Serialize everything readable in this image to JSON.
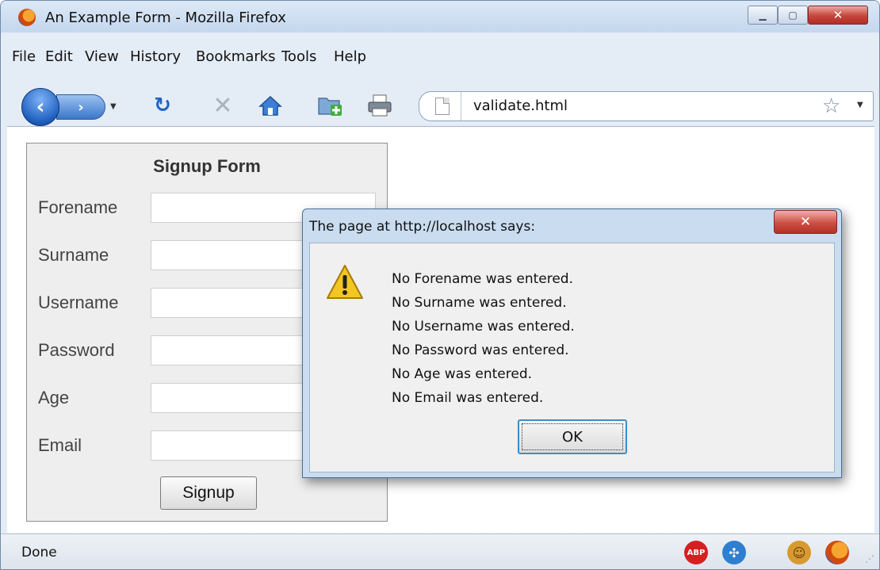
{
  "window": {
    "title": "An Example Form - Mozilla Firefox"
  },
  "menu": [
    {
      "label": "File"
    },
    {
      "label": "Edit"
    },
    {
      "label": "View"
    },
    {
      "label": "History"
    },
    {
      "label": "Bookmarks"
    },
    {
      "label": "Tools"
    },
    {
      "label": "Help"
    }
  ],
  "toolbar": {
    "url": "validate.html",
    "icons": [
      "back-icon",
      "forward-icon",
      "reload-icon",
      "stop-icon",
      "home-icon",
      "new-tab-icon",
      "print-icon",
      "bookmark-star-icon"
    ]
  },
  "form": {
    "title": "Signup Form",
    "fields": [
      {
        "label": "Forename",
        "value": ""
      },
      {
        "label": "Surname",
        "value": ""
      },
      {
        "label": "Username",
        "value": ""
      },
      {
        "label": "Password",
        "value": ""
      },
      {
        "label": "Age",
        "value": ""
      },
      {
        "label": "Email",
        "value": ""
      }
    ],
    "submit_label": "Signup"
  },
  "dialog": {
    "title": "The page at http://localhost says:",
    "messages": [
      "No Forename was entered.",
      "No Surname was entered.",
      "No Username was entered.",
      "No Password was entered.",
      "No Age was entered.",
      "No Email was entered."
    ],
    "ok_label": "OK"
  },
  "status": {
    "text": "Done",
    "abp_label": "ABP"
  },
  "colors": {
    "dialog_border": "#4a6f95",
    "close_red": "#c5453b",
    "ok_focus": "#3a8fc9"
  }
}
